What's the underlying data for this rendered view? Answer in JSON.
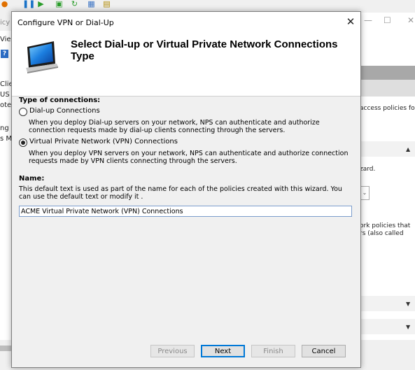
{
  "background": {
    "left_fragments": [
      "icy",
      "Vie",
      "Clien",
      "US C",
      "ote F",
      "ng",
      "s M"
    ],
    "right_fragments": [
      "access policies for",
      "zard.",
      "ork policies that",
      "rs (also called"
    ],
    "toolbar_icons": [
      "stop-icon",
      "pause-icon",
      "play-icon",
      "export-icon",
      "refresh-icon",
      "network-icon",
      "book-icon"
    ],
    "window_buttons": [
      "—",
      "☐",
      "✕"
    ]
  },
  "dialog": {
    "title": "Configure VPN or Dial-Up",
    "close_glyph": "✕",
    "header_title": "Select Dial-up or Virtual Private Network Connections Type",
    "type_label": "Type of connections:",
    "options": [
      {
        "label": "Dial-up Connections",
        "description": "When you deploy Dial-up servers on your network, NPS can authenticate and authorize connection requests made by dial-up clients connecting through the servers.",
        "selected": false
      },
      {
        "label": "Virtual Private Network (VPN) Connections",
        "description": "When you deploy VPN servers on your network, NPS can authenticate and authorize connection requests made by VPN clients connecting through the servers.",
        "selected": true
      }
    ],
    "name_label": "Name:",
    "name_description": "This default text is used as part of the name for each of the policies created with this wizard. You can use the default text or modify it .",
    "name_value": "ACME Virtual Private Network (VPN) Connections",
    "buttons": {
      "previous": "Previous",
      "next": "Next",
      "finish": "Finish",
      "cancel": "Cancel"
    }
  }
}
